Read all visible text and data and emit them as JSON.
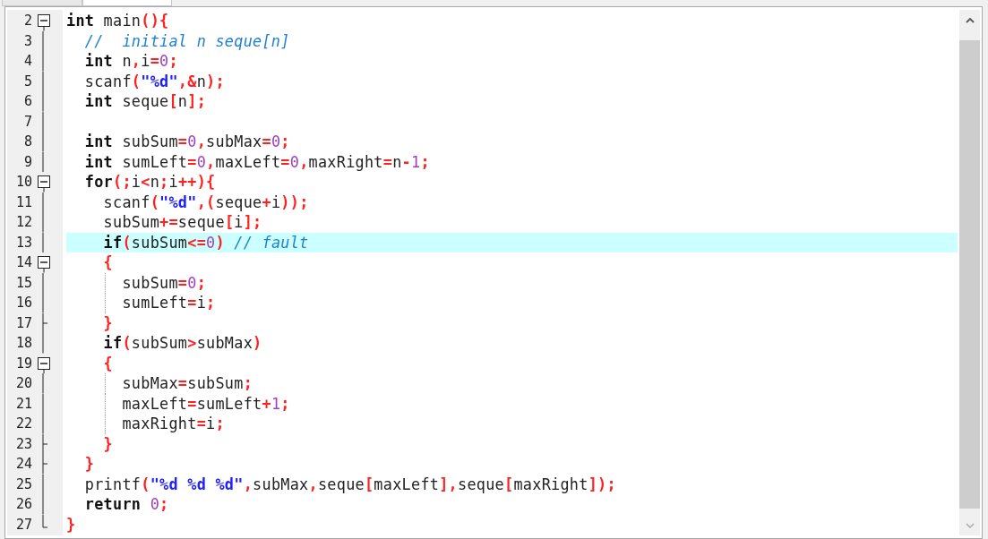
{
  "tabs": [
    {
      "selected": false
    },
    {
      "selected": true
    }
  ],
  "lines": [
    {
      "number": "2",
      "kind": "box",
      "highlighted": false,
      "guide": false,
      "tokens": [
        {
          "kind": "kw",
          "t": "int"
        },
        {
          "kind": "id",
          "t": " main"
        },
        {
          "kind": "op",
          "t": "(){"
        }
      ]
    },
    {
      "number": "3",
      "kind": "line",
      "highlighted": false,
      "guide": false,
      "tokens": [
        {
          "kind": "cmt",
          "t": "  //  initial n seque[n]"
        }
      ]
    },
    {
      "number": "4",
      "kind": "line",
      "highlighted": false,
      "guide": false,
      "tokens": [
        {
          "kind": "kw",
          "t": "  int"
        },
        {
          "kind": "id",
          "t": " n"
        },
        {
          "kind": "op",
          "t": ","
        },
        {
          "kind": "id",
          "t": "i"
        },
        {
          "kind": "op",
          "t": "="
        },
        {
          "kind": "num",
          "t": "0"
        },
        {
          "kind": "op",
          "t": ";"
        }
      ]
    },
    {
      "number": "5",
      "kind": "line",
      "highlighted": false,
      "guide": false,
      "tokens": [
        {
          "kind": "id",
          "t": "  scanf"
        },
        {
          "kind": "op",
          "t": "("
        },
        {
          "kind": "str",
          "t": "\"%d\""
        },
        {
          "kind": "op",
          "t": ",&"
        },
        {
          "kind": "id",
          "t": "n"
        },
        {
          "kind": "op",
          "t": ");"
        }
      ]
    },
    {
      "number": "6",
      "kind": "line",
      "highlighted": false,
      "guide": false,
      "tokens": [
        {
          "kind": "kw",
          "t": "  int"
        },
        {
          "kind": "id",
          "t": " seque"
        },
        {
          "kind": "op",
          "t": "["
        },
        {
          "kind": "id",
          "t": "n"
        },
        {
          "kind": "op",
          "t": "];"
        }
      ]
    },
    {
      "number": "7",
      "kind": "line",
      "highlighted": false,
      "guide": false
    },
    {
      "number": "8",
      "kind": "line",
      "highlighted": false,
      "guide": false,
      "tokens": [
        {
          "kind": "kw",
          "t": "  int"
        },
        {
          "kind": "id",
          "t": " subSum"
        },
        {
          "kind": "op",
          "t": "="
        },
        {
          "kind": "num",
          "t": "0"
        },
        {
          "kind": "op",
          "t": ","
        },
        {
          "kind": "id",
          "t": "subMax"
        },
        {
          "kind": "op",
          "t": "="
        },
        {
          "kind": "num",
          "t": "0"
        },
        {
          "kind": "op",
          "t": ";"
        }
      ]
    },
    {
      "number": "9",
      "kind": "line",
      "highlighted": false,
      "guide": false,
      "tokens": [
        {
          "kind": "kw",
          "t": "  int"
        },
        {
          "kind": "id",
          "t": " sumLeft"
        },
        {
          "kind": "op",
          "t": "="
        },
        {
          "kind": "num",
          "t": "0"
        },
        {
          "kind": "op",
          "t": ","
        },
        {
          "kind": "id",
          "t": "maxLeft"
        },
        {
          "kind": "op",
          "t": "="
        },
        {
          "kind": "num",
          "t": "0"
        },
        {
          "kind": "op",
          "t": ","
        },
        {
          "kind": "id",
          "t": "maxRight"
        },
        {
          "kind": "op",
          "t": "="
        },
        {
          "kind": "id",
          "t": "n"
        },
        {
          "kind": "op",
          "t": "-"
        },
        {
          "kind": "num",
          "t": "1"
        },
        {
          "kind": "op",
          "t": ";"
        }
      ]
    },
    {
      "number": "10",
      "kind": "box",
      "highlighted": false,
      "guide": false,
      "tokens": [
        {
          "kind": "kw",
          "t": "  for"
        },
        {
          "kind": "op",
          "t": "(;"
        },
        {
          "kind": "id",
          "t": "i"
        },
        {
          "kind": "op",
          "t": "<"
        },
        {
          "kind": "id",
          "t": "n"
        },
        {
          "kind": "op",
          "t": ";"
        },
        {
          "kind": "id",
          "t": "i"
        },
        {
          "kind": "op",
          "t": "++){"
        }
      ]
    },
    {
      "number": "11",
      "kind": "line",
      "highlighted": false,
      "guide": false,
      "tokens": [
        {
          "kind": "id",
          "t": "    scanf"
        },
        {
          "kind": "op",
          "t": "("
        },
        {
          "kind": "str",
          "t": "\"%d\""
        },
        {
          "kind": "op",
          "t": ",("
        },
        {
          "kind": "id",
          "t": "seque"
        },
        {
          "kind": "op",
          "t": "+"
        },
        {
          "kind": "id",
          "t": "i"
        },
        {
          "kind": "op",
          "t": "));"
        }
      ]
    },
    {
      "number": "12",
      "kind": "line",
      "highlighted": false,
      "guide": false,
      "tokens": [
        {
          "kind": "id",
          "t": "    subSum"
        },
        {
          "kind": "op",
          "t": "+="
        },
        {
          "kind": "id",
          "t": "seque"
        },
        {
          "kind": "op",
          "t": "["
        },
        {
          "kind": "id",
          "t": "i"
        },
        {
          "kind": "op",
          "t": "];"
        }
      ]
    },
    {
      "number": "13",
      "kind": "line",
      "highlighted": true,
      "guide": false,
      "tokens": [
        {
          "kind": "kw",
          "t": "    if"
        },
        {
          "kind": "op",
          "t": "("
        },
        {
          "kind": "id",
          "t": "subSum"
        },
        {
          "kind": "op",
          "t": "<="
        },
        {
          "kind": "num",
          "t": "0"
        },
        {
          "kind": "op",
          "t": ")"
        },
        {
          "kind": "cmt",
          "t": " // fault"
        }
      ]
    },
    {
      "number": "14",
      "kind": "box",
      "highlighted": false,
      "guide": false,
      "tokens": [
        {
          "kind": "op",
          "t": "    {"
        }
      ]
    },
    {
      "number": "15",
      "kind": "line",
      "highlighted": false,
      "guide": true,
      "tokens": [
        {
          "kind": "id",
          "t": "      subSum"
        },
        {
          "kind": "op",
          "t": "="
        },
        {
          "kind": "num",
          "t": "0"
        },
        {
          "kind": "op",
          "t": ";"
        }
      ]
    },
    {
      "number": "16",
      "kind": "line",
      "highlighted": false,
      "guide": true,
      "tokens": [
        {
          "kind": "id",
          "t": "      sumLeft"
        },
        {
          "kind": "op",
          "t": "="
        },
        {
          "kind": "id",
          "t": "i"
        },
        {
          "kind": "op",
          "t": ";"
        }
      ]
    },
    {
      "number": "17",
      "kind": "tee",
      "highlighted": false,
      "guide": false,
      "tokens": [
        {
          "kind": "op",
          "t": "    }"
        }
      ]
    },
    {
      "number": "18",
      "kind": "line",
      "highlighted": false,
      "guide": false,
      "tokens": [
        {
          "kind": "kw",
          "t": "    if"
        },
        {
          "kind": "op",
          "t": "("
        },
        {
          "kind": "id",
          "t": "subSum"
        },
        {
          "kind": "op",
          "t": ">"
        },
        {
          "kind": "id",
          "t": "subMax"
        },
        {
          "kind": "op",
          "t": ")"
        }
      ]
    },
    {
      "number": "19",
      "kind": "box",
      "highlighted": false,
      "guide": false,
      "tokens": [
        {
          "kind": "op",
          "t": "    {"
        }
      ]
    },
    {
      "number": "20",
      "kind": "line",
      "highlighted": false,
      "guide": true,
      "tokens": [
        {
          "kind": "id",
          "t": "      subMax"
        },
        {
          "kind": "op",
          "t": "="
        },
        {
          "kind": "id",
          "t": "subSum"
        },
        {
          "kind": "op",
          "t": ";"
        }
      ]
    },
    {
      "number": "21",
      "kind": "line",
      "highlighted": false,
      "guide": true,
      "tokens": [
        {
          "kind": "id",
          "t": "      maxLeft"
        },
        {
          "kind": "op",
          "t": "="
        },
        {
          "kind": "id",
          "t": "sumLeft"
        },
        {
          "kind": "op",
          "t": "+"
        },
        {
          "kind": "num",
          "t": "1"
        },
        {
          "kind": "op",
          "t": ";"
        }
      ]
    },
    {
      "number": "22",
      "kind": "line",
      "highlighted": false,
      "guide": true,
      "tokens": [
        {
          "kind": "id",
          "t": "      maxRight"
        },
        {
          "kind": "op",
          "t": "="
        },
        {
          "kind": "id",
          "t": "i"
        },
        {
          "kind": "op",
          "t": ";"
        }
      ]
    },
    {
      "number": "23",
      "kind": "tee",
      "highlighted": false,
      "guide": false,
      "tokens": [
        {
          "kind": "op",
          "t": "    }"
        }
      ]
    },
    {
      "number": "24",
      "kind": "tee",
      "highlighted": false,
      "guide": false,
      "tokens": [
        {
          "kind": "op",
          "t": "  }"
        }
      ]
    },
    {
      "number": "25",
      "kind": "line",
      "highlighted": false,
      "guide": false,
      "tokens": [
        {
          "kind": "id",
          "t": "  printf"
        },
        {
          "kind": "op",
          "t": "("
        },
        {
          "kind": "str",
          "t": "\"%d %d %d\""
        },
        {
          "kind": "op",
          "t": ","
        },
        {
          "kind": "id",
          "t": "subMax"
        },
        {
          "kind": "op",
          "t": ","
        },
        {
          "kind": "id",
          "t": "seque"
        },
        {
          "kind": "op",
          "t": "["
        },
        {
          "kind": "id",
          "t": "maxLeft"
        },
        {
          "kind": "op",
          "t": "],"
        },
        {
          "kind": "id",
          "t": "seque"
        },
        {
          "kind": "op",
          "t": "["
        },
        {
          "kind": "id",
          "t": "maxRight"
        },
        {
          "kind": "op",
          "t": "]);"
        }
      ]
    },
    {
      "number": "26",
      "kind": "line",
      "highlighted": false,
      "guide": false,
      "tokens": [
        {
          "kind": "kw",
          "t": "  return"
        },
        {
          "kind": "num",
          "t": " 0"
        },
        {
          "kind": "op",
          "t": ";"
        }
      ]
    },
    {
      "number": "27",
      "kind": "corner",
      "highlighted": false,
      "guide": false,
      "tokens": [
        {
          "kind": "op",
          "t": "}"
        }
      ]
    }
  ]
}
